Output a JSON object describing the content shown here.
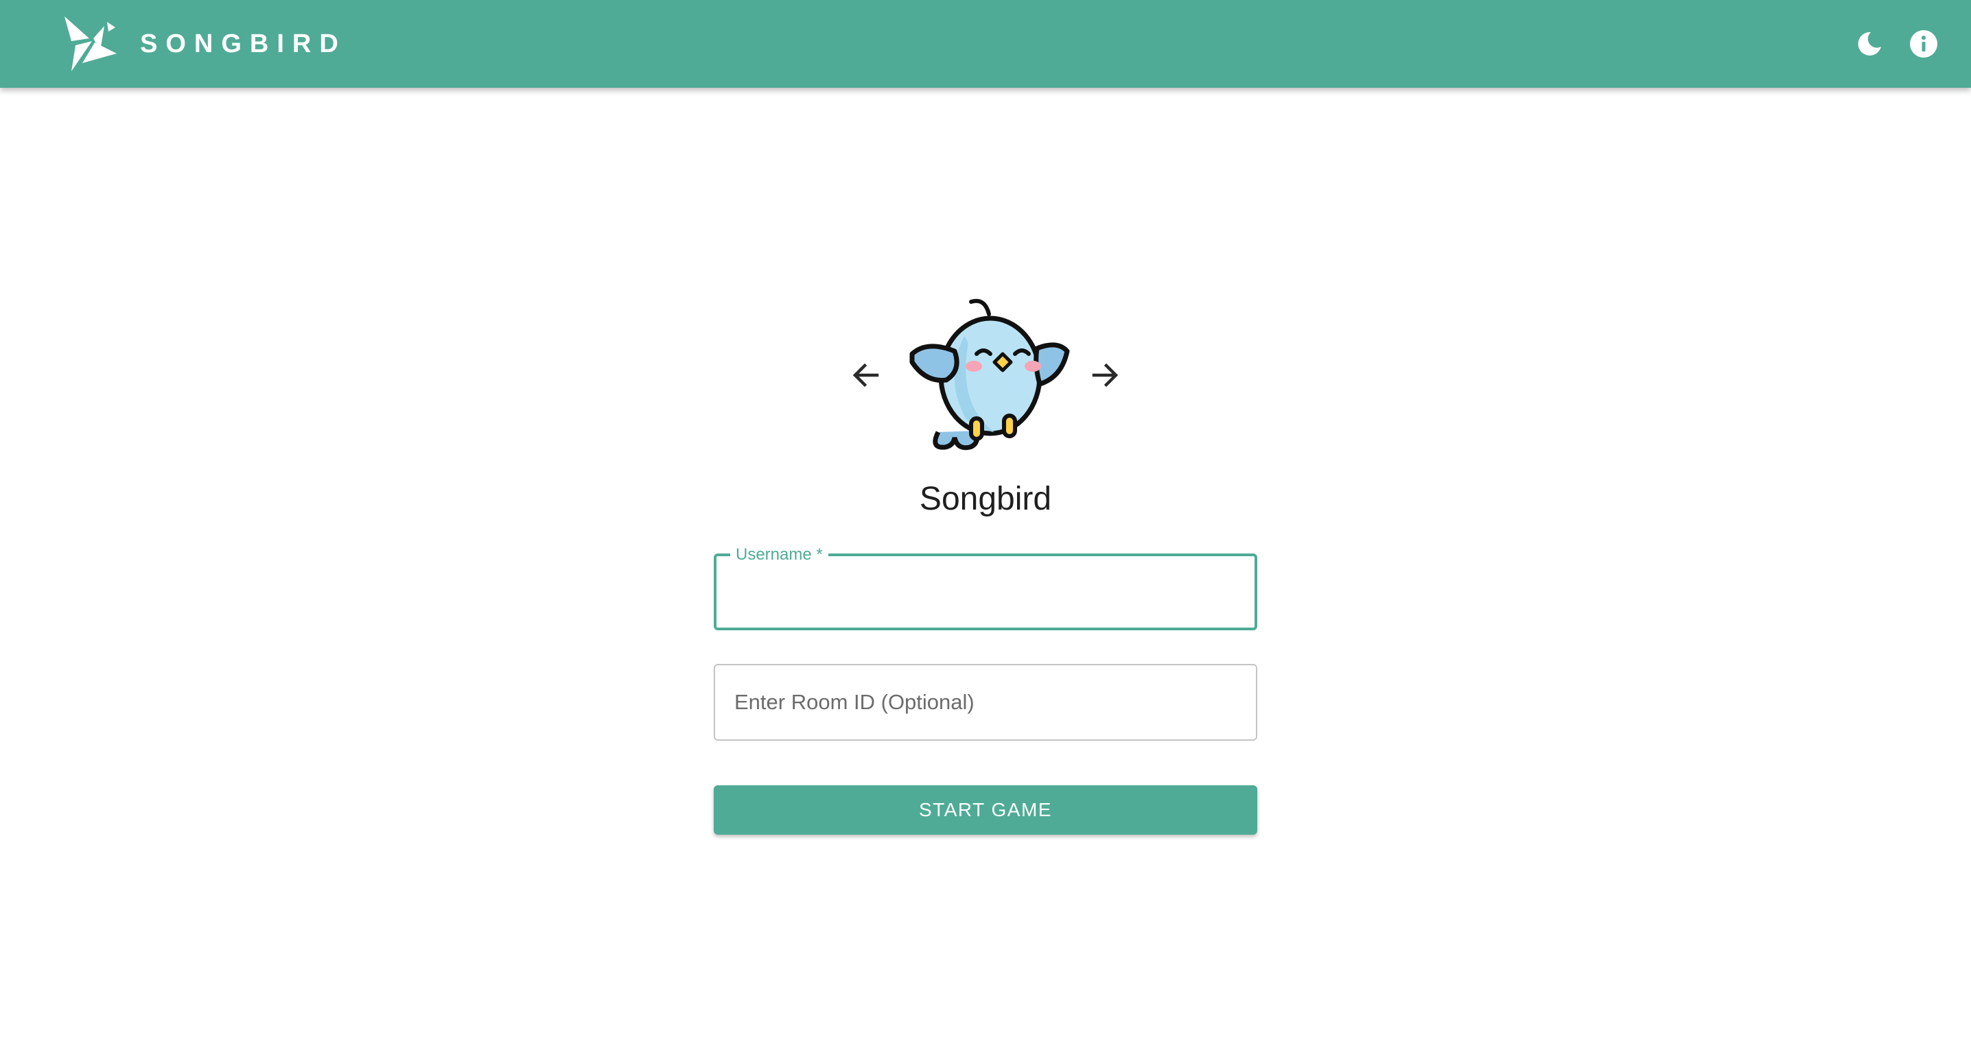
{
  "appbar": {
    "brand": "SONGBIRD",
    "background": "#4fab96",
    "logo_icon": "origami-bird-icon",
    "actions": [
      {
        "name": "dark-mode-toggle",
        "icon": "moon-icon"
      },
      {
        "name": "info-button",
        "icon": "info-icon"
      }
    ]
  },
  "main": {
    "avatar_prev_icon": "arrow-left-icon",
    "avatar_next_icon": "arrow-right-icon",
    "avatar_icon": "bird-avatar-icon",
    "title": "Songbird",
    "username": {
      "label": "Username *",
      "value": ""
    },
    "room": {
      "placeholder": "Enter Room ID (Optional)",
      "value": ""
    },
    "start_button": "START GAME"
  }
}
